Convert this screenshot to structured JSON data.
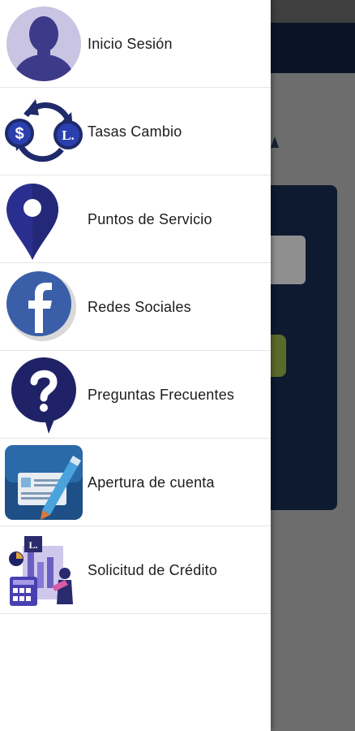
{
  "drawer": {
    "items": [
      {
        "label": "Inicio Sesión",
        "icon": "user-avatar-icon"
      },
      {
        "label": "Tasas Cambio",
        "icon": "currency-exchange-icon"
      },
      {
        "label": "Puntos de Servicio",
        "icon": "location-pin-icon"
      },
      {
        "label": "Redes Sociales",
        "icon": "facebook-icon"
      },
      {
        "label": "Preguntas Frecuentes",
        "icon": "question-bubble-icon"
      },
      {
        "label": "Apertura de cuenta",
        "icon": "account-form-icon"
      },
      {
        "label": "Solicitud de Crédito",
        "icon": "credit-request-icon"
      }
    ]
  },
  "icon_glyphs": {
    "dollar": "$",
    "lempira": "L."
  },
  "colors": {
    "drawer_bg": "#ffffff",
    "icon_navy": "#2a2a6e",
    "icon_blue": "#2f3fa0",
    "avatar_bg": "#c9c4e2",
    "avatar_fg": "#3d3a8a",
    "toolbar": "#0b1427",
    "scrim": "#6d6d6d",
    "accent_green": "#5b6a2a"
  }
}
